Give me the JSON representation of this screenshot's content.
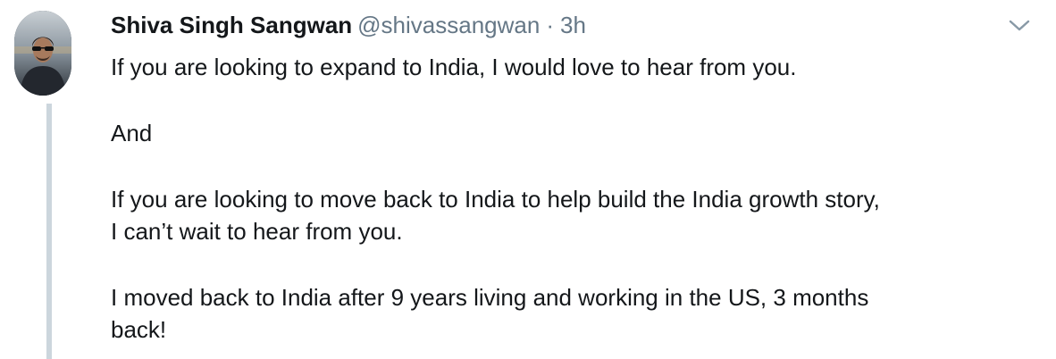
{
  "tweet": {
    "author": {
      "display_name": "Shiva Singh Sangwan",
      "handle": "@shivassangwan",
      "separator": "·",
      "time": "3h",
      "avatar": "profile-photo"
    },
    "menu_icon": "chevron-down-icon",
    "paragraphs": {
      "p1": "If you are looking to expand to India, I would love to hear from you.",
      "p2": "And",
      "p3_line1": "If you are looking to move back to India to help build the India growth story,",
      "p3_line2": "I can’t wait to hear from you.",
      "p4_line1": "I moved back to India after 9 years living and working in the US, 3 months",
      "p4_line2": "back!"
    },
    "colors": {
      "text": "#14171a",
      "secondary": "#657786",
      "thread_line": "#ccd6dd"
    }
  }
}
